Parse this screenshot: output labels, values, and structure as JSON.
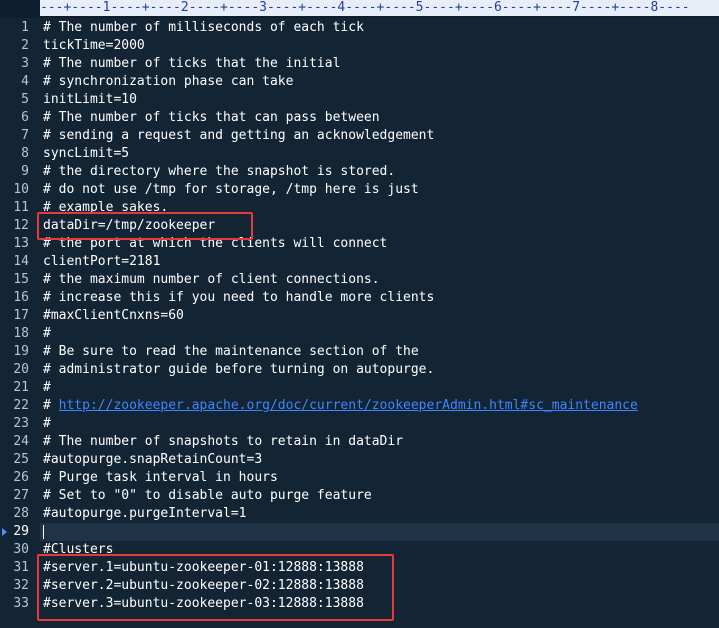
{
  "ruler": {
    "text": "---+----1----+----2----+----3----+----4----+----5----+----6----+----7----+----8----"
  },
  "editor": {
    "current_line": 29,
    "lines": [
      {
        "n": "1",
        "text": "# The number of milliseconds of each tick"
      },
      {
        "n": "2",
        "text": "tickTime=2000"
      },
      {
        "n": "3",
        "text": "# The number of ticks that the initial"
      },
      {
        "n": "4",
        "text": "# synchronization phase can take"
      },
      {
        "n": "5",
        "text": "initLimit=10"
      },
      {
        "n": "6",
        "text": "# The number of ticks that can pass between"
      },
      {
        "n": "7",
        "text": "# sending a request and getting an acknowledgement"
      },
      {
        "n": "8",
        "text": "syncLimit=5"
      },
      {
        "n": "9",
        "text": "# the directory where the snapshot is stored."
      },
      {
        "n": "10",
        "text": "# do not use /tmp for storage, /tmp here is just"
      },
      {
        "n": "11",
        "text": "# example sakes."
      },
      {
        "n": "12",
        "text": "dataDir=/tmp/zookeeper"
      },
      {
        "n": "13",
        "text": "# the port at which the clients will connect"
      },
      {
        "n": "14",
        "text": "clientPort=2181"
      },
      {
        "n": "15",
        "text": "# the maximum number of client connections."
      },
      {
        "n": "16",
        "text": "# increase this if you need to handle more clients"
      },
      {
        "n": "17",
        "text": "#maxClientCnxns=60"
      },
      {
        "n": "18",
        "text": "#"
      },
      {
        "n": "19",
        "text": "# Be sure to read the maintenance section of the"
      },
      {
        "n": "20",
        "text": "# administrator guide before turning on autopurge."
      },
      {
        "n": "21",
        "text": "#"
      },
      {
        "n": "22",
        "text": "# ",
        "link": "http://zookeeper.apache.org/doc/current/zookeeperAdmin.html#sc_maintenance"
      },
      {
        "n": "23",
        "text": "#"
      },
      {
        "n": "24",
        "text": "# The number of snapshots to retain in dataDir"
      },
      {
        "n": "25",
        "text": "#autopurge.snapRetainCount=3"
      },
      {
        "n": "26",
        "text": "# Purge task interval in hours"
      },
      {
        "n": "27",
        "text": "# Set to \"0\" to disable auto purge feature"
      },
      {
        "n": "28",
        "text": "#autopurge.purgeInterval=1"
      },
      {
        "n": "29",
        "text": ""
      },
      {
        "n": "30",
        "text": "#Clusters"
      },
      {
        "n": "31",
        "text": "#server.1=ubuntu-zookeeper-01:12888:13888"
      },
      {
        "n": "32",
        "text": "#server.2=ubuntu-zookeeper-02:12888:13888"
      },
      {
        "n": "33",
        "text": "#server.3=ubuntu-zookeeper-03:12888:13888"
      }
    ]
  },
  "annotations": {
    "color": "#e53a3a"
  },
  "colors": {
    "background": "#132435",
    "current_line": "#1f3347",
    "text": "#ffffff",
    "line_number": "#b8c4d2",
    "link": "#3c86ff",
    "ruler_bg": "#e8eef8",
    "ruler_fg": "#1f3f9f"
  }
}
